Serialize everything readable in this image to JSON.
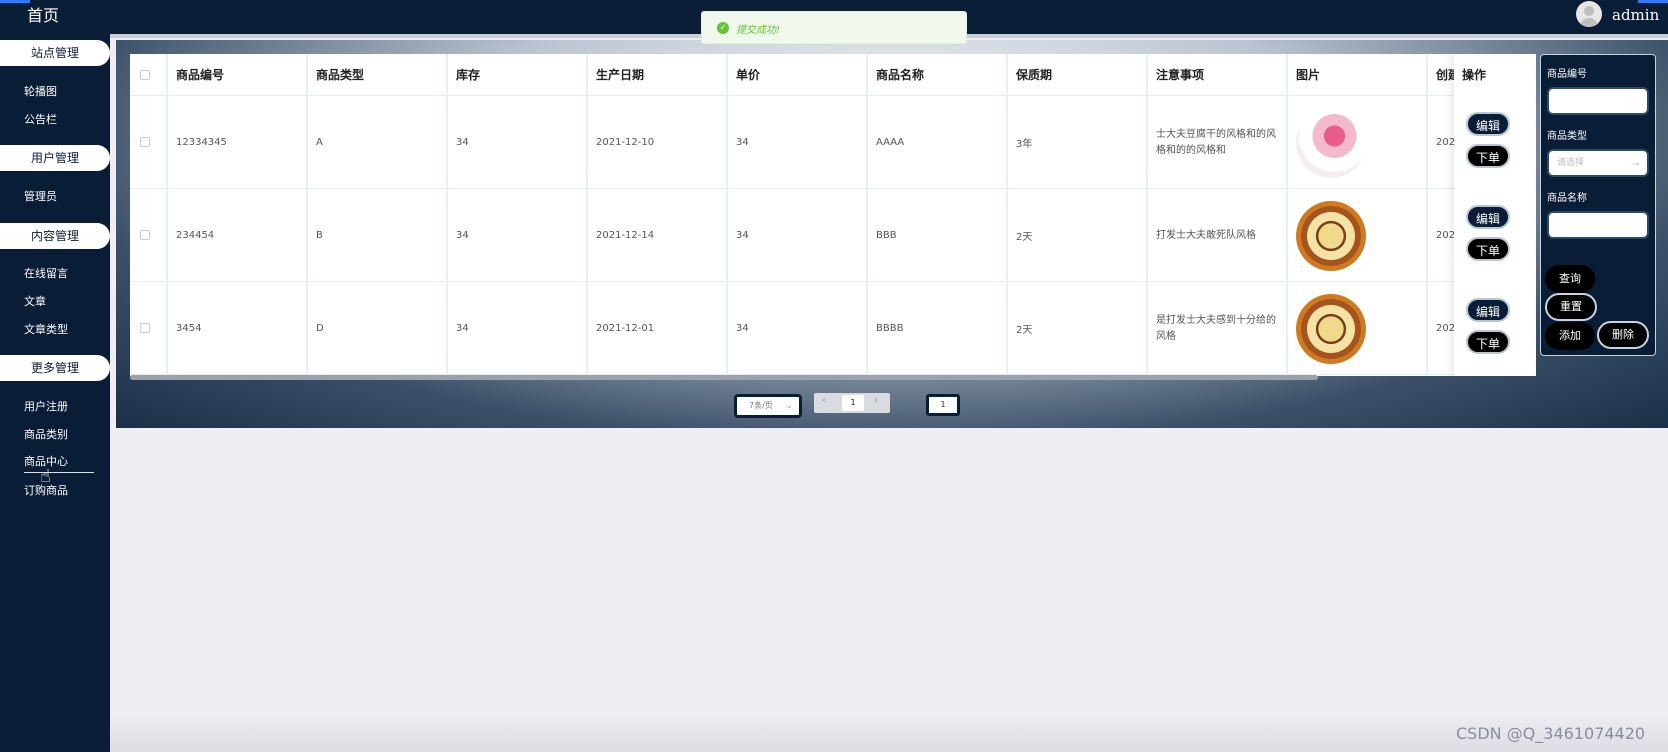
{
  "sidebar": {
    "home": "首页",
    "groups": [
      {
        "title": "站点管理",
        "items": [
          "轮播图",
          "公告栏"
        ]
      },
      {
        "title": "用户管理",
        "items": [
          "管理员"
        ]
      },
      {
        "title": "内容管理",
        "items": [
          "在线留言",
          "文章",
          "文章类型"
        ]
      },
      {
        "title": "更多管理",
        "items": [
          "用户注册",
          "商品类别",
          "商品中心",
          "订购商品"
        ]
      }
    ],
    "active_item": "商品中心"
  },
  "topbar": {
    "user_name": "admin"
  },
  "toast": {
    "message": "提交成功!",
    "type": "success"
  },
  "table": {
    "headers": [
      "商品编号",
      "商品类型",
      "库存",
      "生产日期",
      "单价",
      "商品名称",
      "保质期",
      "注意事项",
      "图片",
      "创建"
    ],
    "op_header": "操作",
    "rows": [
      {
        "code": "12334345",
        "type": "A",
        "stock": "34",
        "date": "2021-12-10",
        "price": "34",
        "name": "AAAA",
        "shelf": "3年",
        "note": "士大夫豆腐干的风格和的风格和的的风格和",
        "created": "202",
        "image": "cake-pink-icon"
      },
      {
        "code": "234454",
        "type": "B",
        "stock": "34",
        "date": "2021-12-14",
        "price": "34",
        "name": "BBB",
        "shelf": "2天",
        "note": "打发士大夫敢死队风格",
        "created": "202",
        "image": "cake-cream-icon"
      },
      {
        "code": "3454",
        "type": "D",
        "stock": "34",
        "date": "2021-12-01",
        "price": "34",
        "name": "BBBB",
        "shelf": "2天",
        "note": "是打发士大夫感到十分给的风格",
        "created": "202",
        "image": "cake-cream-icon"
      }
    ],
    "edit_label": "编辑",
    "order_label": "下单"
  },
  "pagination": {
    "page_size": "7条/页",
    "current_page": "1",
    "jump_value": "1"
  },
  "search": {
    "code_label": "商品编号",
    "type_label": "商品类型",
    "type_placeholder": "请选择",
    "name_label": "商品名称",
    "query_label": "查询",
    "reset_label": "重置",
    "add_label": "添加",
    "delete_label": "删除"
  },
  "watermark": "CSDN @Q_3461074420",
  "colors": {
    "sidebar": "#0a1d36",
    "success": "#67c23a",
    "button_dark": "#000000"
  }
}
